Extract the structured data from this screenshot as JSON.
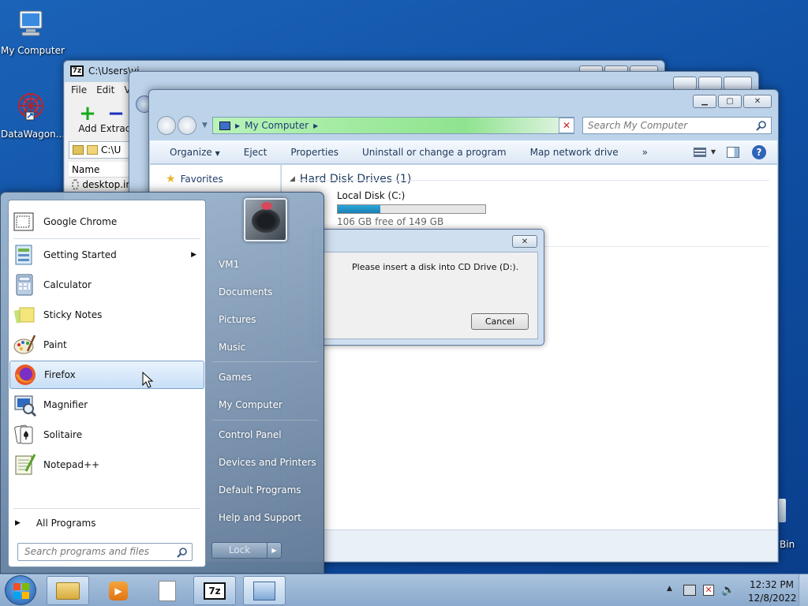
{
  "desktop": {
    "icons": [
      {
        "label": "My Computer"
      },
      {
        "label": "DataWagon..."
      }
    ],
    "recycle_label_partial": "Bin"
  },
  "sevenzip": {
    "title": "C:\\Users\\vi",
    "menu": [
      "File",
      "Edit",
      "V"
    ],
    "toolbar": {
      "add": "Add",
      "extract": "Extract"
    },
    "path": "C:\\U",
    "column_name": "Name",
    "row": "desktop.in"
  },
  "explorer": {
    "address": "My Computer",
    "search_placeholder": "Search My Computer",
    "commands": [
      "Organize",
      "Eject",
      "Properties",
      "Uninstall or change a program",
      "Map network drive",
      "»"
    ],
    "nav": {
      "favorites": "Favorites"
    },
    "group_header": "Hard Disk Drives (1)",
    "drive": {
      "name": "Local Disk (C:)",
      "free_text": "106 GB free of 149 GB",
      "used_fraction": 0.29
    }
  },
  "dialog": {
    "message": "Please insert a disk into CD Drive (D:).",
    "cancel_label": "Cancel"
  },
  "startmenu": {
    "programs": [
      {
        "label": "Google Chrome",
        "icon": "chrome-icon"
      },
      {
        "label": "Getting Started",
        "icon": "getting-started-icon",
        "submenu": true
      },
      {
        "label": "Calculator",
        "icon": "calculator-icon"
      },
      {
        "label": "Sticky Notes",
        "icon": "sticky-notes-icon"
      },
      {
        "label": "Paint",
        "icon": "paint-icon"
      },
      {
        "label": "Firefox",
        "icon": "firefox-icon",
        "selected": true
      },
      {
        "label": "Magnifier",
        "icon": "magnifier-icon"
      },
      {
        "label": "Solitaire",
        "icon": "solitaire-icon"
      },
      {
        "label": "Notepad++",
        "icon": "notepadpp-icon"
      }
    ],
    "all_programs": "All Programs",
    "search_placeholder": "Search programs and files",
    "right_items": [
      "VM1",
      "Documents",
      "Pictures",
      "Music",
      "Games",
      "My Computer",
      "Control Panel",
      "Devices and Printers",
      "Default Programs",
      "Help and Support"
    ],
    "lock_label": "Lock"
  },
  "taskbar": {
    "time": "12:32 PM",
    "date": "12/8/2022"
  }
}
